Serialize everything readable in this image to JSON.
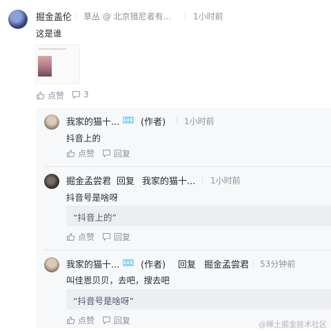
{
  "comment": {
    "author": "掘金盖伦",
    "position": "草丛 @ 北京猎尼者有...",
    "time": "1小时前",
    "content": "这是谁",
    "like_label": "点赞",
    "reply_count": "3"
  },
  "replies": [
    {
      "author": "我家的猫十...",
      "level": "Lv1",
      "author_tag": "(作者)",
      "time": "1小时前",
      "content": "抖音上的",
      "like_label": "点赞",
      "reply_label": "回复"
    },
    {
      "author": "掘金孟尝君",
      "reply_word": "回复",
      "reply_to": "我家的猫十...",
      "time": "1小时前",
      "content": "抖音号是啥呀",
      "quote": "“抖音上的”",
      "like_label": "点赞",
      "reply_label": "回复"
    },
    {
      "author": "我家的猫十...",
      "level": "Lv1",
      "author_tag": "(作者)",
      "reply_word": "回复",
      "reply_to": "掘金孟尝君",
      "time": "53分钟前",
      "content": "叫佳恩贝贝，去吧，搜去吧",
      "quote": "“抖音号是啥呀”",
      "like_label": "点赞",
      "reply_label": "回复"
    }
  ],
  "watermark": "@稀土掘金技术社区"
}
